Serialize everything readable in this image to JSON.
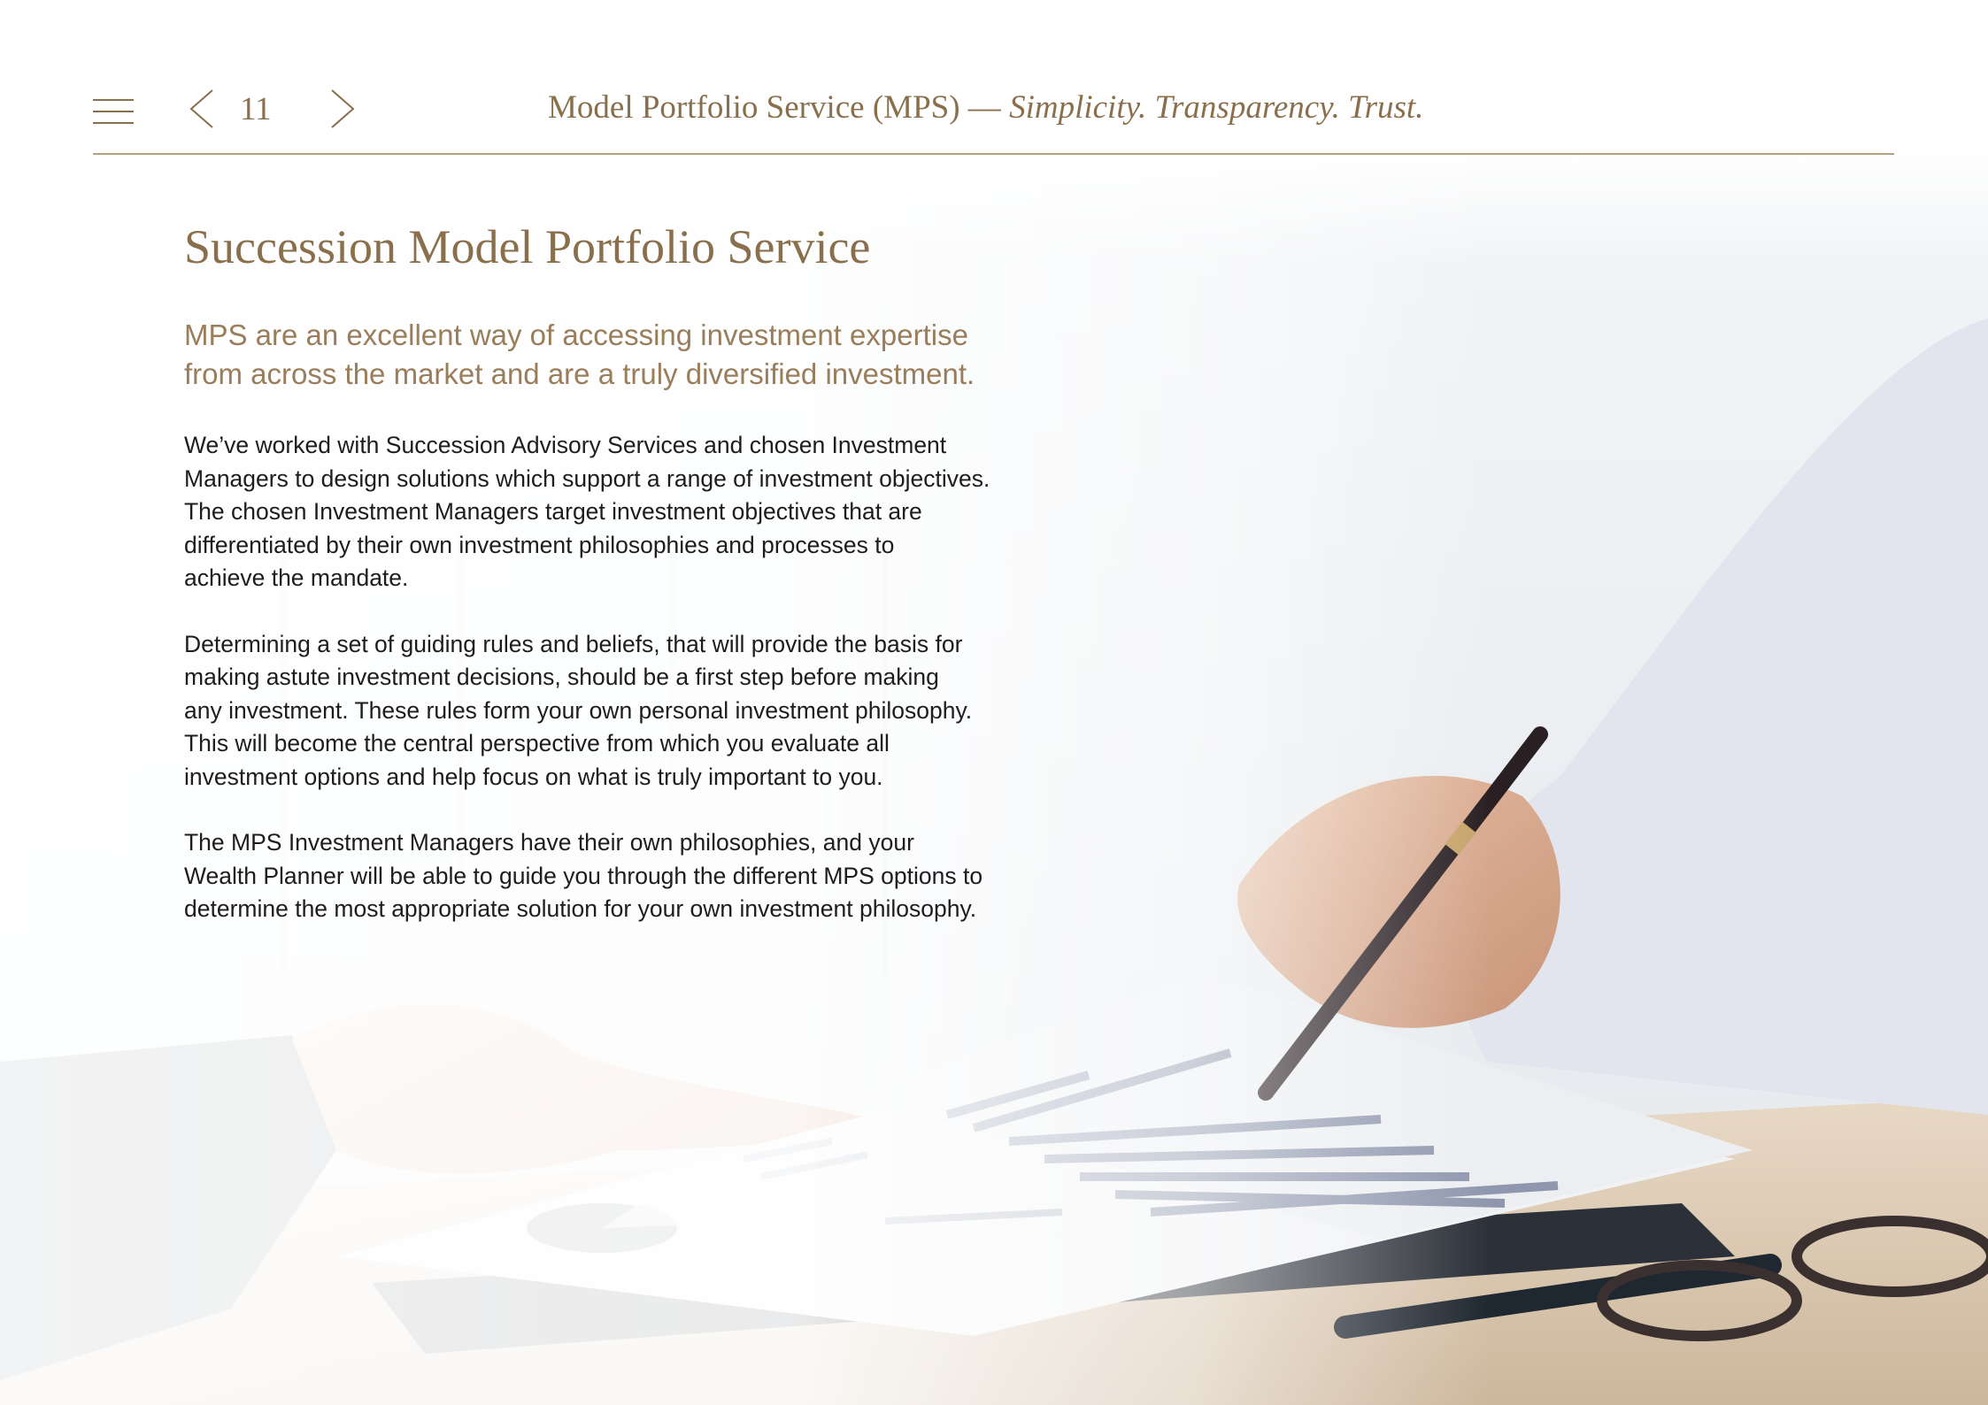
{
  "header": {
    "page_number": "11",
    "title_main": "Model Portfolio Service (MPS) — ",
    "title_tagline": "Simplicity. Transparency. Trust."
  },
  "content": {
    "heading": "Succession Model Portfolio Service",
    "intro_line_1": "MPS are an excellent way of accessing investment expertise",
    "intro_line_2": "from across the market and are a truly diversified investment.",
    "paragraphs": [
      [
        "We’ve worked with Succession Advisory Services and chosen Investment",
        "Managers to design solutions which support a range of investment objectives.",
        "The chosen Investment Managers target investment objectives that are",
        "differentiated by their own investment philosophies and processes to",
        "achieve the mandate."
      ],
      [
        "Determining a set of guiding rules and beliefs, that will provide the basis for",
        "making astute investment decisions, should be a first step before making",
        "any investment. These rules form your own personal investment philosophy.",
        "This will become the central perspective from which you evaluate all",
        "investment options and help focus on what is truly important to you."
      ],
      [
        "The MPS Investment Managers have their own philosophies, and your",
        "Wealth Planner will be able to guide you through the different MPS options to",
        "determine the most appropriate solution for your own investment philosophy."
      ]
    ]
  },
  "icons": {
    "menu": "hamburger-menu-icon",
    "previous": "chevron-left-icon",
    "next": "chevron-right-icon"
  },
  "colors": {
    "accent": "#8a6f4c",
    "intro": "#9a7d5a",
    "body": "#1d1d1f",
    "rule": "#b89f80"
  }
}
